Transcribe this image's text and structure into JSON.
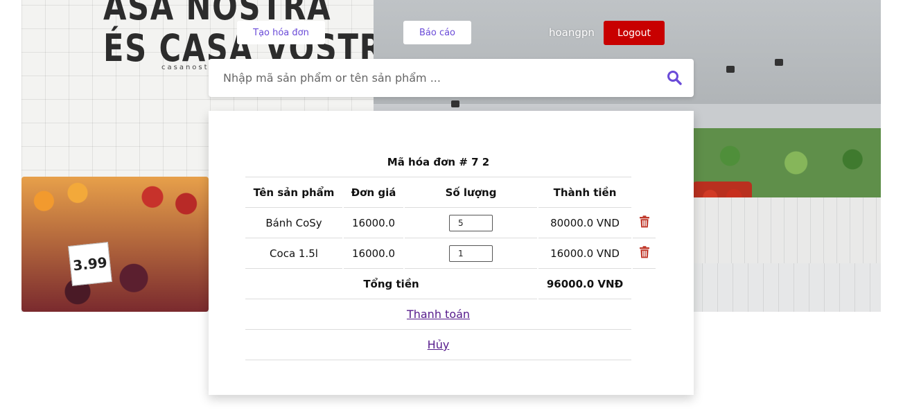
{
  "hero": {
    "sign_line1": "ASA NOSTRA",
    "sign_line2": "ÉS CASA VOSTRA",
    "sign_small": "casanostra",
    "price_tag": "3.99"
  },
  "nav": {
    "create_invoice": "Tạo hóa đơn",
    "report": "Báo cáo",
    "username": "hoangpn",
    "logout": "Logout"
  },
  "search": {
    "placeholder": "Nhập mã sản phẩm or tên sản phẩm ...",
    "value": ""
  },
  "invoice": {
    "title": "Mã hóa đơn # 7 2",
    "headers": {
      "name": "Tên sản phẩm",
      "price": "Đơn giá",
      "qty": "Số lượng",
      "total": "Thành tiền"
    },
    "rows": [
      {
        "name": "Bánh CoSy",
        "price": "16000.0",
        "qty": "5",
        "total": "80000.0 VND"
      },
      {
        "name": "Coca 1.5l",
        "price": "16000.0",
        "qty": "1",
        "total": "16000.0 VND"
      }
    ],
    "total_label": "Tổng tiền",
    "total_value": "96000.0 VNĐ",
    "pay_link": "Thanh toán",
    "cancel_link": "Hủy"
  },
  "colors": {
    "accent": "#6a4bd8",
    "logout": "#c80000",
    "trash": "#c0392b",
    "link": "#551a8b"
  },
  "icons": {
    "search": "search-icon",
    "delete": "trash-icon"
  }
}
